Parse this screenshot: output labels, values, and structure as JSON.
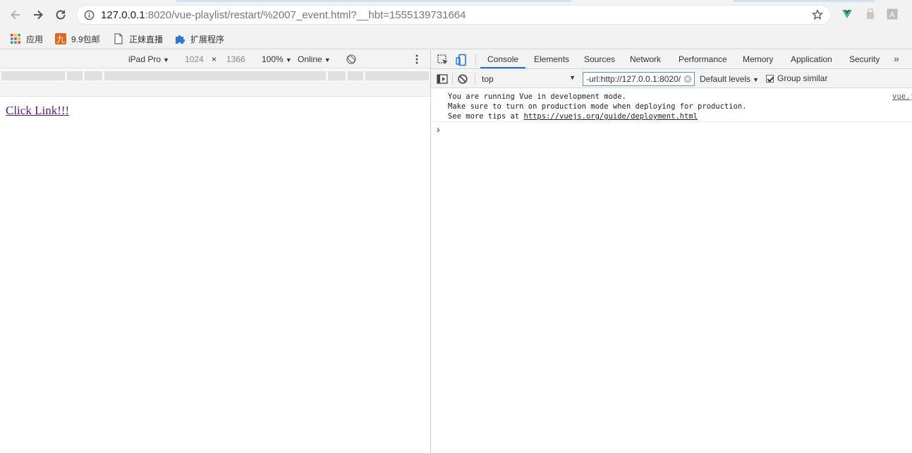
{
  "browser": {
    "url_host": "127.0.0.1",
    "url_rest": ":8020/vue-playlist/restart/%2007_event.html?__hbt=1555139731664",
    "extensions": [
      "vue-devtools-icon",
      "extension-icon",
      "translate-icon"
    ]
  },
  "bookmarks": [
    {
      "label": "应用",
      "icon": "apps-grid-icon"
    },
    {
      "label": "9.9包邮",
      "icon": "jiu-icon"
    },
    {
      "label": "正妹直播",
      "icon": "page-icon"
    },
    {
      "label": "扩展程序",
      "icon": "puzzle-icon"
    }
  ],
  "device_toolbar": {
    "device": "iPad Pro",
    "width": "1024",
    "times": "×",
    "height": "1366",
    "zoom": "100%",
    "network": "Online"
  },
  "page": {
    "link_text": "Click Link!!!"
  },
  "devtools": {
    "tabs": [
      "Console",
      "Elements",
      "Sources",
      "Network",
      "Performance",
      "Memory",
      "Application",
      "Security"
    ],
    "active_tab": "Console",
    "more": "»"
  },
  "console": {
    "context": "top",
    "filter_value": "-url:http://127.0.0.1:8020/",
    "levels": "Default levels",
    "group_similar": "Group similar",
    "message_lines": [
      "You are running Vue in development mode.",
      "Make sure to turn on production mode when deploying for production.",
      "See more tips at "
    ],
    "message_link": "https://vuejs.org/guide/deployment.html",
    "message_source": "vue.js",
    "prompt": "›"
  },
  "colors": {
    "link_visited": "#551a8b",
    "accent": "#1a73e8",
    "vue_green": "#41b883"
  }
}
